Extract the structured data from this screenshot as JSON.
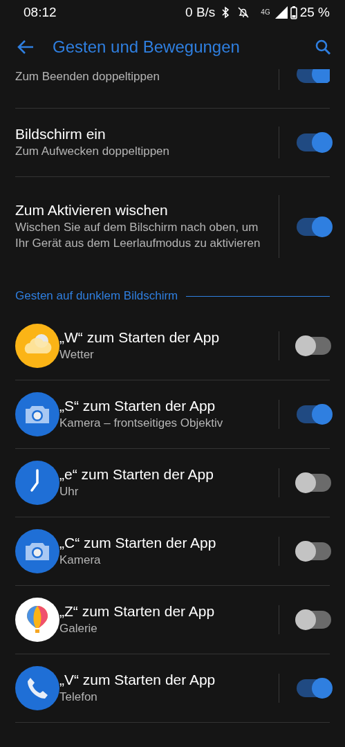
{
  "status_bar": {
    "time": "08:12",
    "speed": "0 B/s",
    "network_type": "4G",
    "battery": "25 %"
  },
  "app_bar": {
    "title": "Gesten und Bewegungen"
  },
  "partial_item": {
    "subtitle": "Zum Beenden doppeltippen",
    "on": true
  },
  "settings": [
    {
      "title": "Bildschirm ein",
      "subtitle": "Zum Aufwecken doppeltippen",
      "on": true
    },
    {
      "title": "Zum Aktivieren wischen",
      "subtitle": "Wischen Sie auf dem Bilschirm nach oben, um Ihr Gerät aus dem Leerlaufmodus zu aktivieren",
      "on": true
    }
  ],
  "section": {
    "title": "Gesten auf dunklem Bildschirm"
  },
  "gestures": [
    {
      "title": "„W“ zum Starten der App",
      "subtitle": "Wetter",
      "on": false
    },
    {
      "title": "„S“ zum Starten der App",
      "subtitle": "Kamera – frontseitiges Objektiv",
      "on": true
    },
    {
      "title": "„e“ zum Starten der App",
      "subtitle": "Uhr",
      "on": false
    },
    {
      "title": "„C“ zum Starten der App",
      "subtitle": "Kamera",
      "on": false
    },
    {
      "title": "„Z“ zum Starten der App",
      "subtitle": "Galerie",
      "on": false
    },
    {
      "title": "„V“ zum Starten der App",
      "subtitle": "Telefon",
      "on": true
    }
  ]
}
